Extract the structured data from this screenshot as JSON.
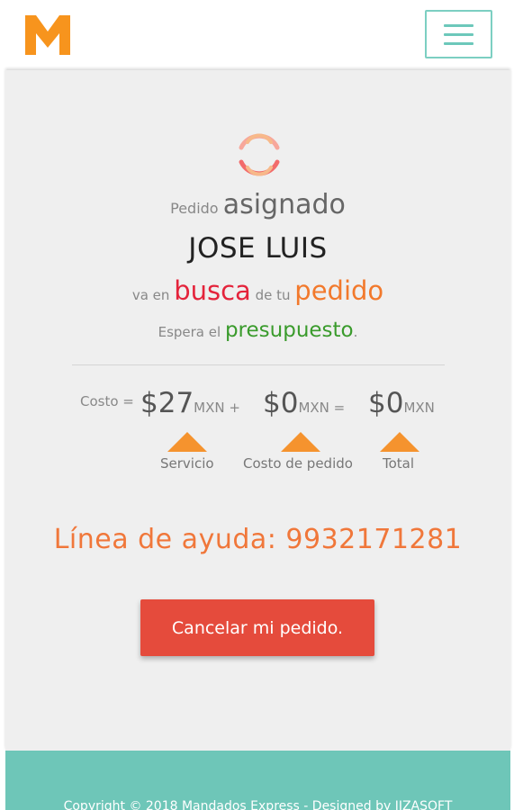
{
  "header": {
    "logo_letter": "M",
    "brand_color": "#f7941d",
    "menu_icon": "hamburger-icon"
  },
  "status": {
    "pedido_label": "Pedido",
    "assigned_word": "asignado",
    "driver_name": "JOSE LUIS",
    "va_en": "va en",
    "busca": "busca",
    "de_tu": "de tu",
    "pedido": "pedido",
    "espera_el": "Espera el",
    "presupuesto": "presupuesto",
    "period": "."
  },
  "cost": {
    "label": "Costo =",
    "service_amount": "$27",
    "service_currency": "MXN +",
    "order_amount": "$0",
    "order_currency": "MXN =",
    "total_amount": "$0",
    "total_currency": "MXN",
    "service_caption": "Servicio",
    "order_caption": "Costo de pedido",
    "total_caption": "Total"
  },
  "helpline": "Línea de ayuda: 9932171281",
  "cancel_button": "Cancelar mi pedido.",
  "footer": {
    "copyright": "Copyright © 2018 Mandados Express - Designed by IIZASOFT"
  },
  "colors": {
    "accent_teal": "#6ec6b8",
    "busca_red": "#e4233b",
    "pedido_orange": "#f2792c",
    "presupuesto_green": "#3a9b2c",
    "cancel_red": "#e54b3c",
    "triangle_orange": "#f5932e"
  }
}
